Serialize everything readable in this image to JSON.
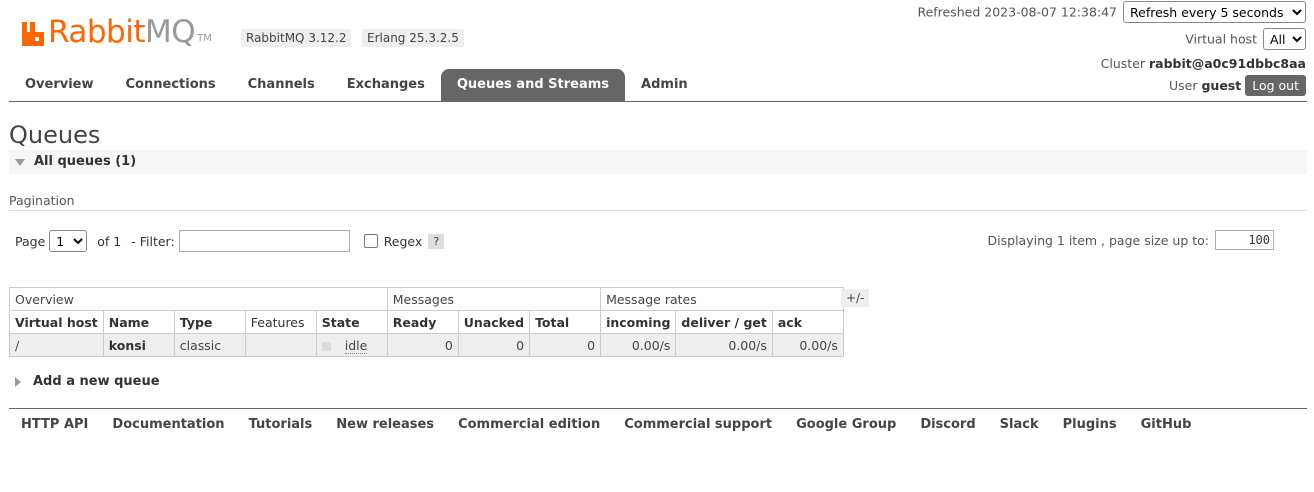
{
  "brand": {
    "name_part1": "Rabbit",
    "name_part2": "MQ",
    "trademark": "TM",
    "rabbitmq_version": "RabbitMQ 3.12.2",
    "erlang_version": "Erlang 25.3.2.5",
    "accent": "#ff6600"
  },
  "header": {
    "refreshed_label": "Refreshed 2023-08-07 12:38:47",
    "refresh_select": "Refresh every 5 seconds",
    "vhost_label": "Virtual host",
    "vhost_select": "All",
    "cluster_label": "Cluster",
    "cluster_name": "rabbit@a0c91dbbc8aa",
    "user_label": "User",
    "user_name": "guest",
    "logout": "Log out"
  },
  "tabs": [
    {
      "label": "Overview"
    },
    {
      "label": "Connections"
    },
    {
      "label": "Channels"
    },
    {
      "label": "Exchanges"
    },
    {
      "label": "Queues and Streams",
      "active": true
    },
    {
      "label": "Admin"
    }
  ],
  "main": {
    "title": "Queues",
    "all_queues": "All queues (1)",
    "pagination_title": "Pagination",
    "page_label": "Page",
    "page_select": "1",
    "of_label": "of 1",
    "filter_label": "- Filter:",
    "regex_label": "Regex",
    "help": "?",
    "displaying": "Displaying 1 item , page size up to:",
    "page_size": "100",
    "plus_minus": "+/-",
    "add_queue": "Add a new queue"
  },
  "table": {
    "groups": [
      "Overview",
      "Messages",
      "Message rates"
    ],
    "headers": [
      "Virtual host",
      "Name",
      "Type",
      "Features",
      "State",
      "Ready",
      "Unacked",
      "Total",
      "incoming",
      "deliver / get",
      "ack"
    ],
    "rows": [
      {
        "vhost": "/",
        "name": "konsi",
        "type": "classic",
        "features": "",
        "state": "idle",
        "ready": "0",
        "unacked": "0",
        "total": "0",
        "incoming": "0.00/s",
        "deliver_get": "0.00/s",
        "ack": "0.00/s"
      }
    ]
  },
  "footer": [
    "HTTP API",
    "Documentation",
    "Tutorials",
    "New releases",
    "Commercial edition",
    "Commercial support",
    "Google Group",
    "Discord",
    "Slack",
    "Plugins",
    "GitHub"
  ]
}
